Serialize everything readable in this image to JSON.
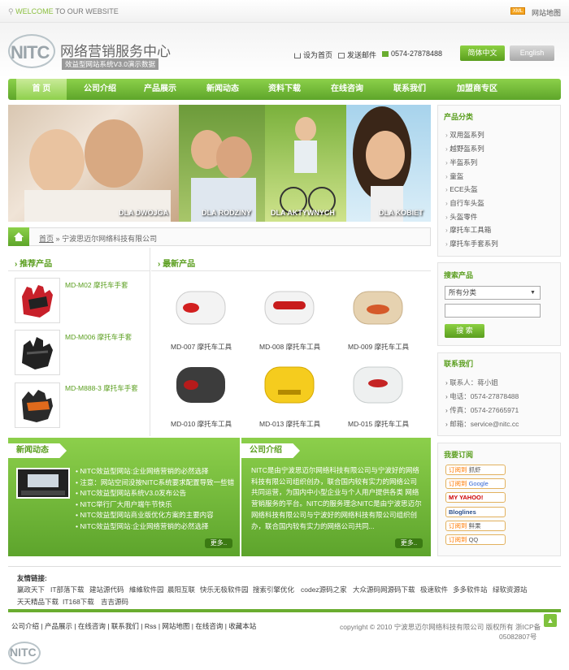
{
  "topbar": {
    "welcome_prefix": "WELCOME",
    "welcome_rest": "TO OUR WEBSITE",
    "xml": "XML",
    "sitemap": "网站地图"
  },
  "header": {
    "logo": "NITC",
    "site_name": "网络营销服务中心",
    "version": "效益型网站系统V3.0演示数据",
    "set_home": "设为首页",
    "send_mail": "发送邮件",
    "phone": "0574-27878488",
    "btn_cn": "简体中文",
    "btn_en": "English"
  },
  "nav": [
    "首 页",
    "公司介绍",
    "产品展示",
    "新闻动态",
    "资料下载",
    "在线咨询",
    "联系我们",
    "加盟商专区"
  ],
  "banner": [
    "DLA DWOJGA",
    "DLA RODZINY",
    "DLA AKTYWNYCH",
    "DLA KOBIET"
  ],
  "breadcrumb": {
    "home": "首页",
    "sep": "»",
    "current": "宁波思迈尔网络科技有限公司"
  },
  "recommended": {
    "title": "推荐产品",
    "items": [
      "MD-M02 摩托车手套",
      "MD-M006 摩托车手套",
      "MD-M888-3 摩托车手套"
    ]
  },
  "latest": {
    "title": "最新产品",
    "items": [
      "MD-007 摩托车工具",
      "MD-008 摩托车工具",
      "MD-009 摩托车工具",
      "MD-010 摩托车工具",
      "MD-013 摩托车工具",
      "MD-015 摩托车工具"
    ]
  },
  "news": {
    "title": "新闻动态",
    "items": [
      "NITC效益型网站:企业网络营销的必然选择",
      "注意：网站空间没按NITC系统要求配置导致一些错",
      "NITC效益型网站系统V3.0发布公告",
      "NITC举行厂大用户端午节快乐",
      "NITC效益型网站商业版优化方案的主要内容",
      "NITC效益型网站:企业网络营销的必然选择"
    ],
    "more": "更多.."
  },
  "about": {
    "title": "公司介绍",
    "text": "NITC是由宁波思迈尔网络科技有限公司与宁波好的网络科技有限公司组织创办，联合国内较有实力的网络公司共同运营，为国内中小型企业与个人用户提供各类 网络营销服务的平台。NITC的服务理念NITC是由宁波思迈尔网络科技有限公司与宁波好的网络科技有限公司组织创办，联合国内较有实力的网络公司共同...",
    "more": "更多.."
  },
  "sidebar": {
    "categories_title": "产品分类",
    "categories": [
      "双用盔系列",
      "越野盔系列",
      "半盔系列",
      "童盔",
      "ECE头盔",
      "自行车头盔",
      "头盔零件",
      "摩托车工具箱",
      "摩托车手套系列"
    ],
    "search_title": "搜索产品",
    "search_select": "所有分类",
    "search_btn": "搜 索",
    "contact_title": "联系我们",
    "contact": [
      "联系人：蒋小姐",
      "电话：0574-27878488",
      "传真：0574-27665971",
      "邮箱：service@nitc.cc"
    ],
    "subscribe_title": "我要订阅",
    "subscribe": [
      "抓虾",
      "Google",
      "MY YAHOO!",
      "Bloglines",
      "鲜果",
      "QQ"
    ],
    "subscribe_prefix": "订阅到"
  },
  "links": {
    "title": "友情链接:",
    "items": [
      "赢政天下",
      "IT部落下载",
      "建站源代码",
      "維維软件园",
      "晨阳互联",
      "快乐无极软件园",
      "搜索引擎优化",
      "codez源码之家",
      "大众源码网源码下载",
      "极速软件",
      "多多软件站",
      "绿软资源站",
      "天天精品下载",
      "IT168下载",
      "吉吉源码"
    ]
  },
  "footer": {
    "nav": [
      "公司介绍",
      "产品展示",
      "在线咨询",
      "联系我们",
      "Rss",
      "网站地图",
      "在线咨询",
      "收藏本站"
    ],
    "copyright": "copyright © 2010 宁波思迈尔网络科技有限公司 版权所有 浙ICP备",
    "icp": "05082807号",
    "top": "▲"
  }
}
